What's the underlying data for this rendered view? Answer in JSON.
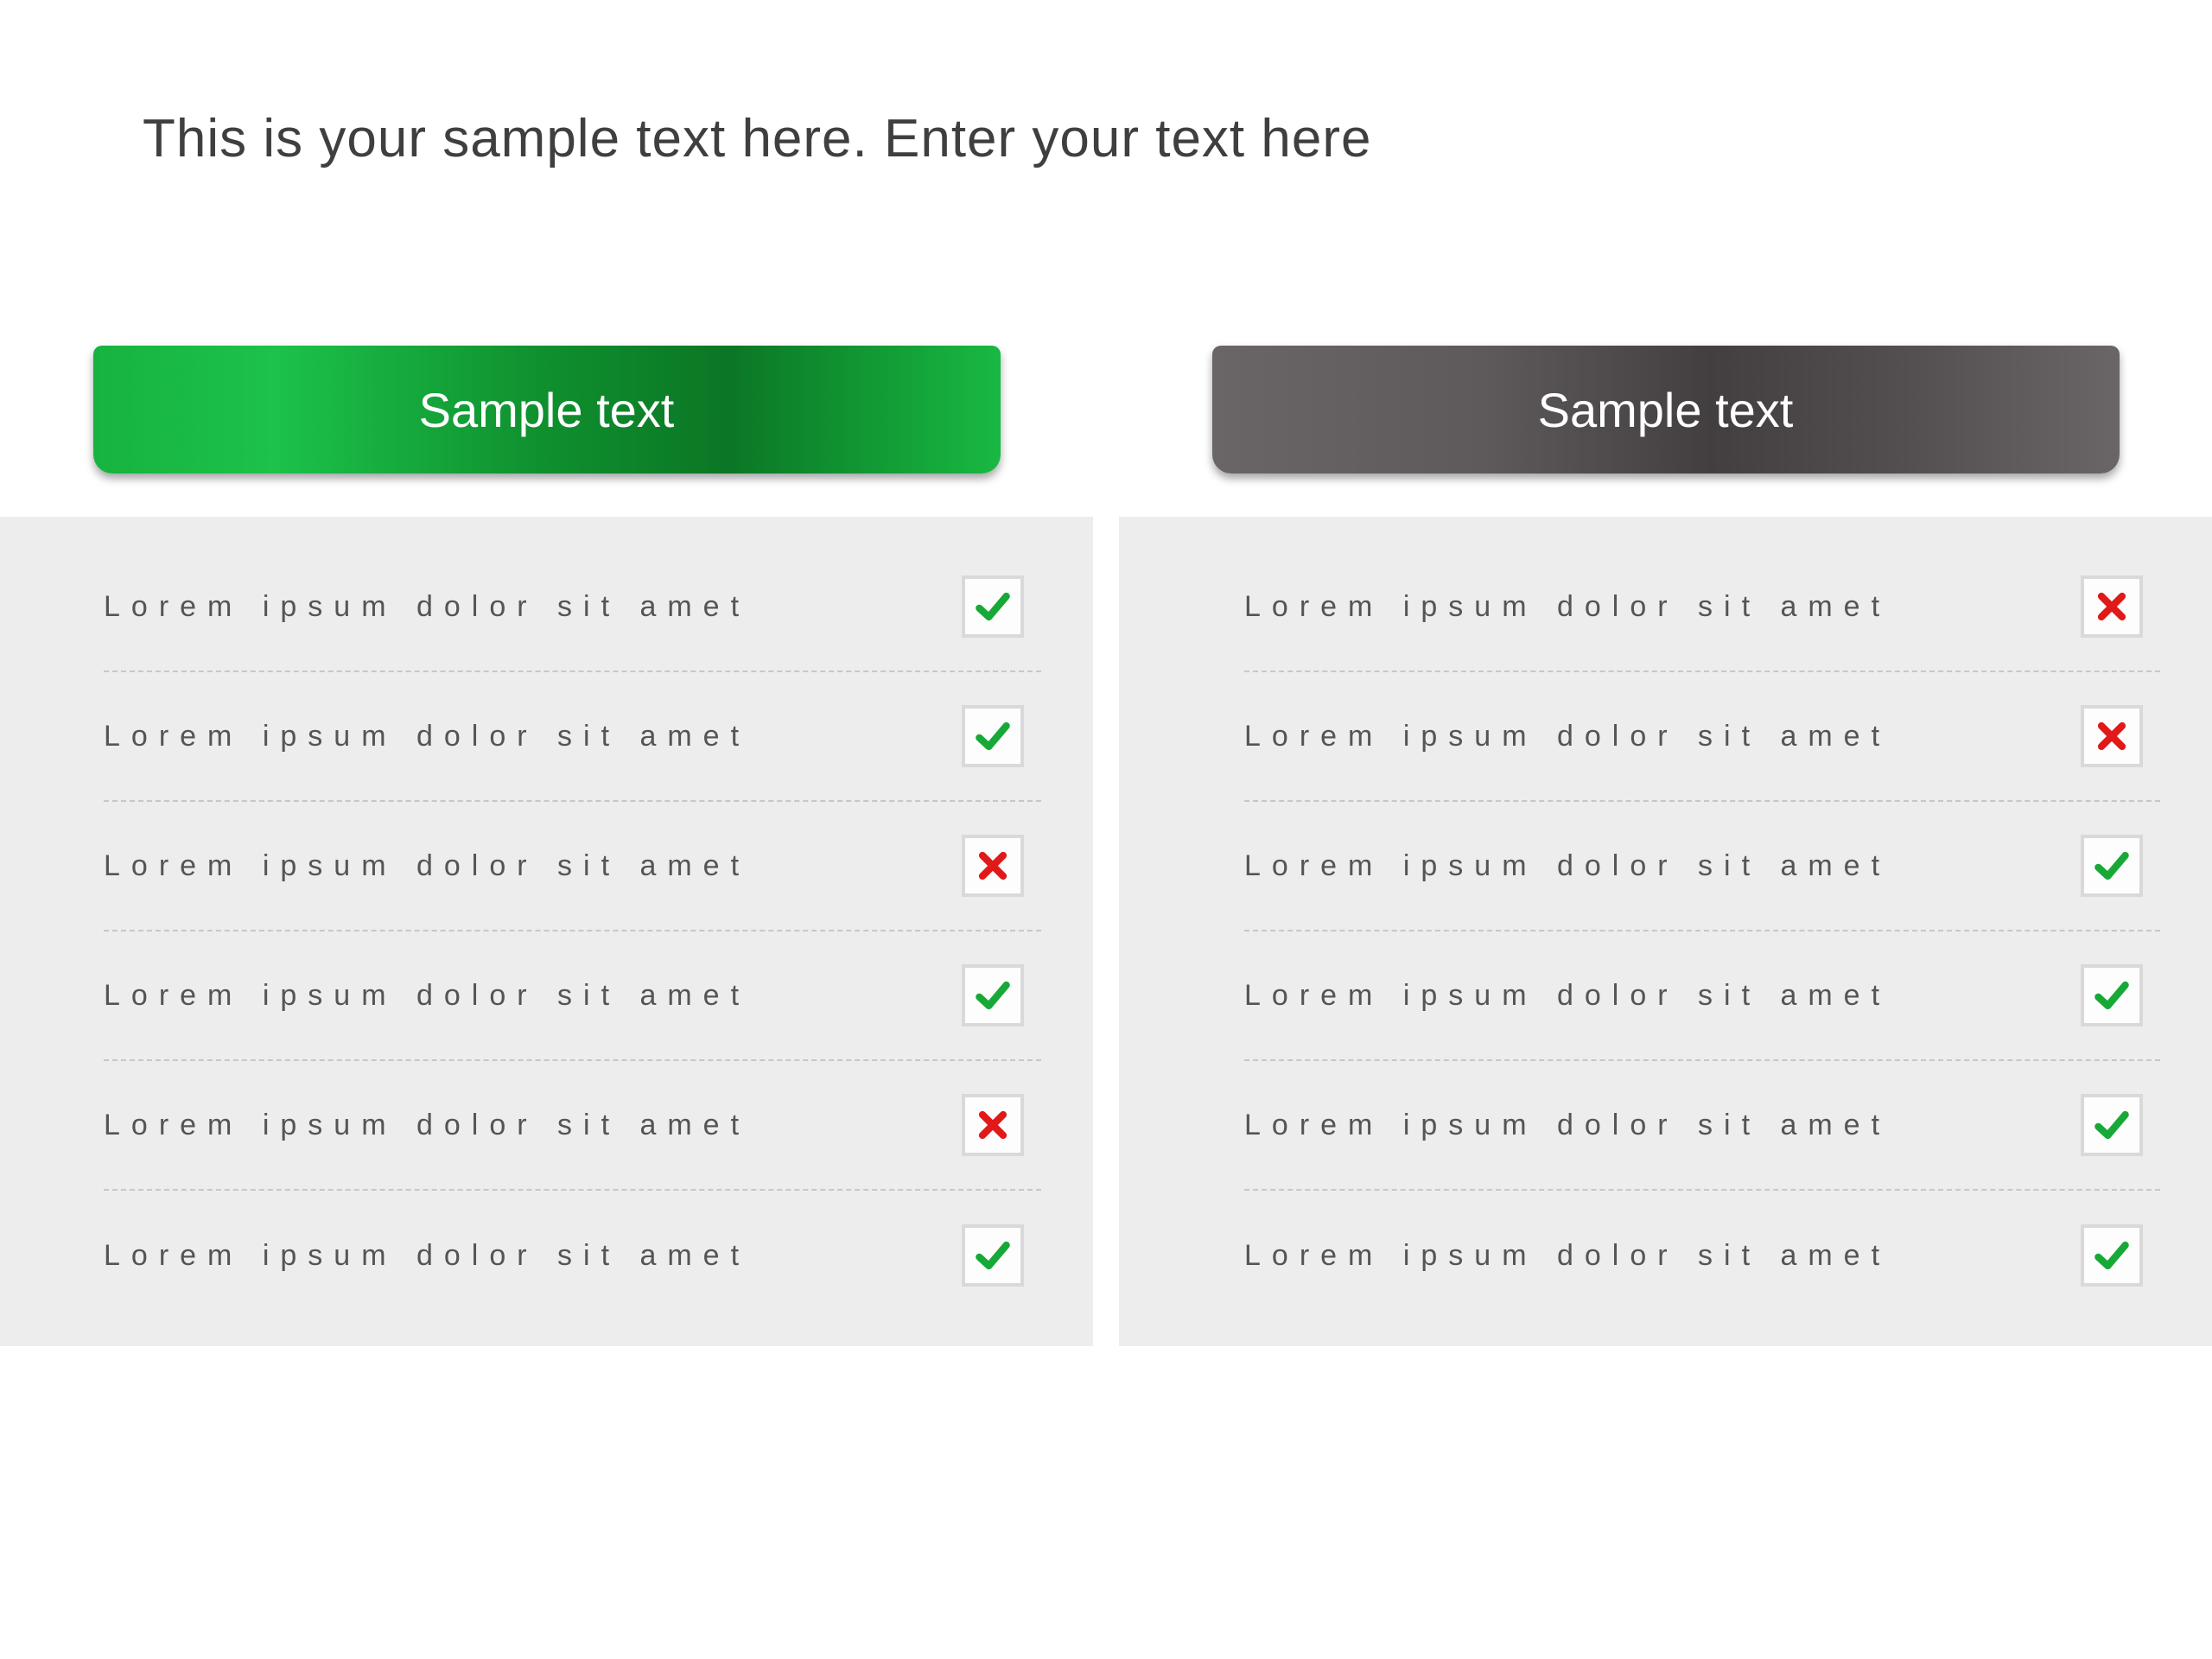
{
  "title": "This is your sample text here. Enter your text here",
  "columns": [
    {
      "header": "Sample text",
      "header_style": "green",
      "rows": [
        {
          "label": "Lorem ipsum dolor sit amet",
          "status": "check"
        },
        {
          "label": "Lorem ipsum dolor sit amet",
          "status": "check"
        },
        {
          "label": "Lorem ipsum dolor sit amet",
          "status": "cross"
        },
        {
          "label": "Lorem ipsum dolor sit amet",
          "status": "check"
        },
        {
          "label": "Lorem ipsum dolor sit amet",
          "status": "cross"
        },
        {
          "label": "Lorem ipsum dolor sit amet",
          "status": "check"
        }
      ]
    },
    {
      "header": "Sample text",
      "header_style": "gray",
      "rows": [
        {
          "label": "Lorem ipsum dolor sit amet",
          "status": "cross"
        },
        {
          "label": "Lorem ipsum dolor sit amet",
          "status": "cross"
        },
        {
          "label": "Lorem ipsum dolor sit amet",
          "status": "check"
        },
        {
          "label": "Lorem ipsum dolor sit amet",
          "status": "check"
        },
        {
          "label": "Lorem ipsum dolor sit amet",
          "status": "check"
        },
        {
          "label": "Lorem ipsum dolor sit amet",
          "status": "check"
        }
      ]
    }
  ]
}
